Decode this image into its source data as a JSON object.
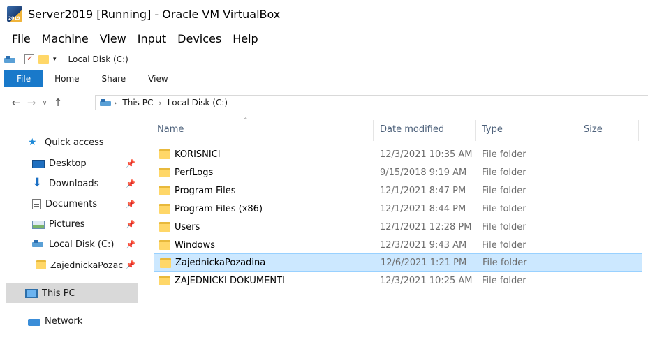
{
  "window": {
    "title": "Server2019 [Running] - Oracle VM VirtualBox",
    "logo_text": "2019"
  },
  "vbox_menu": [
    "File",
    "Machine",
    "View",
    "Input",
    "Devices",
    "Help"
  ],
  "explorer": {
    "title": "Local Disk (C:)",
    "ribbon_tabs": [
      "File",
      "Home",
      "Share",
      "View"
    ],
    "breadcrumb": [
      "This PC",
      "Local Disk (C:)"
    ]
  },
  "nav_pane": {
    "quick_access": "Quick access",
    "items": [
      {
        "label": "Desktop",
        "icon": "desktop-icon",
        "pinned": true
      },
      {
        "label": "Downloads",
        "icon": "download-icon",
        "pinned": true
      },
      {
        "label": "Documents",
        "icon": "documents-icon",
        "pinned": true
      },
      {
        "label": "Pictures",
        "icon": "pictures-icon",
        "pinned": true
      },
      {
        "label": "Local Disk (C:)",
        "icon": "drive-icon",
        "pinned": true
      },
      {
        "label": "ZajednickaPozac",
        "icon": "folder-icon",
        "pinned": true
      }
    ],
    "this_pc": "This PC",
    "network": "Network"
  },
  "columns": {
    "name": "Name",
    "date": "Date modified",
    "type": "Type",
    "size": "Size"
  },
  "files": [
    {
      "name": "KORISNICI",
      "date": "12/3/2021 10:35 AM",
      "type": "File folder"
    },
    {
      "name": "PerfLogs",
      "date": "9/15/2018 9:19 AM",
      "type": "File folder"
    },
    {
      "name": "Program Files",
      "date": "12/1/2021 8:47 PM",
      "type": "File folder"
    },
    {
      "name": "Program Files (x86)",
      "date": "12/1/2021 8:44 PM",
      "type": "File folder"
    },
    {
      "name": "Users",
      "date": "12/1/2021 12:28 PM",
      "type": "File folder"
    },
    {
      "name": "Windows",
      "date": "12/3/2021 9:43 AM",
      "type": "File folder"
    },
    {
      "name": "ZajednickaPozadina",
      "date": "12/6/2021 1:21 PM",
      "type": "File folder",
      "selected": true
    },
    {
      "name": "ZAJEDNICKI DOKUMENTI",
      "date": "12/3/2021 10:25 AM",
      "type": "File folder"
    }
  ],
  "colors": {
    "accent": "#1979ca",
    "selection": "#cce8ff",
    "folder": "#ffd768"
  }
}
